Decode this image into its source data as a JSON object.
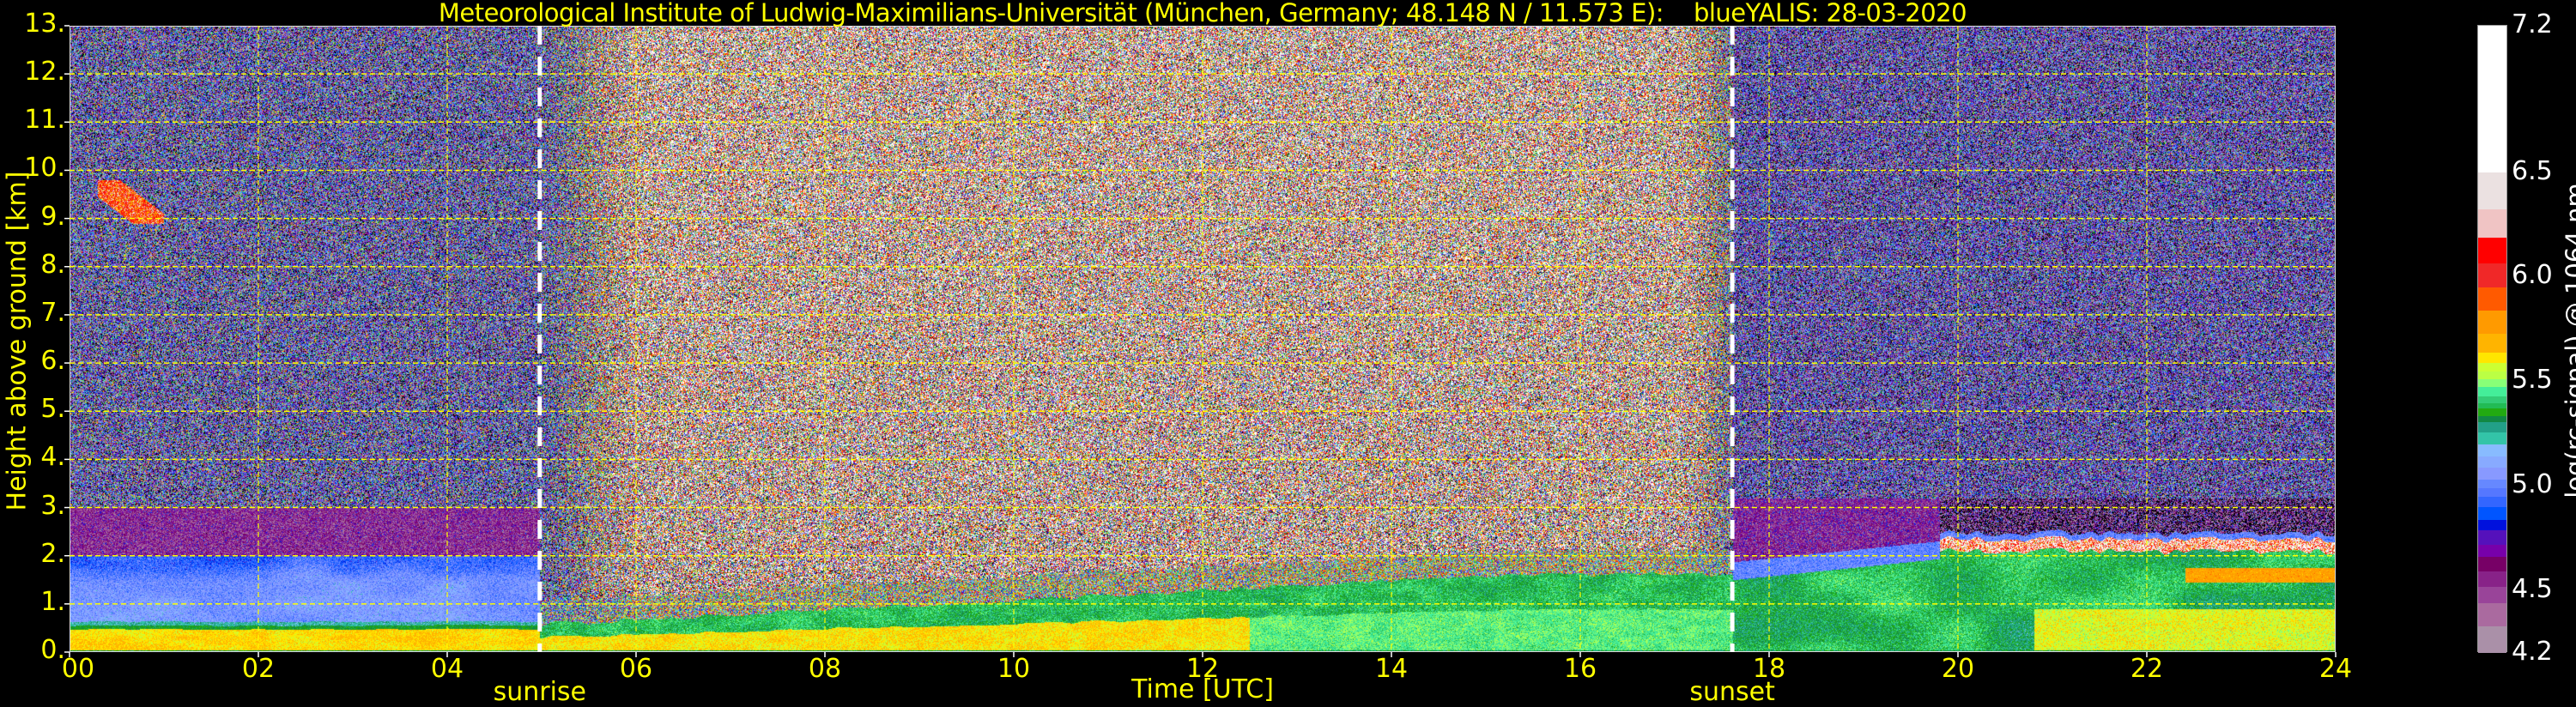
{
  "chart_data": {
    "type": "heatmap",
    "title": "Meteorological Institute of Ludwig-Maximilians-Universität (München, Germany; 48.148 N / 11.573 E):    blueYALIS: 28-03-2020",
    "xlabel": "Time [UTC]",
    "ylabel": "Height above ground [km]",
    "xlim": [
      0,
      24
    ],
    "ylim": [
      0,
      13
    ],
    "grid": true,
    "grid_color": "#ffff00",
    "x_ticks": [
      0,
      2,
      4,
      6,
      8,
      10,
      12,
      14,
      16,
      18,
      20,
      22,
      24
    ],
    "x_tick_labels": [
      "00",
      "02",
      "04",
      "06",
      "08",
      "10",
      "12",
      "14",
      "16",
      "18",
      "20",
      "22",
      "24"
    ],
    "y_ticks": [
      0,
      1,
      2,
      3,
      4,
      5,
      6,
      7,
      8,
      9,
      10,
      11,
      12,
      13
    ],
    "y_tick_labels": [
      "0.",
      "1.",
      "2.",
      "3.",
      "4.",
      "5.",
      "6.",
      "7.",
      "8.",
      "9.",
      "10.",
      "11.",
      "12.",
      "13."
    ],
    "annotations": [
      {
        "label": "sunrise",
        "time": 4.98
      },
      {
        "label": "sunset",
        "time": 17.61
      }
    ],
    "colorbar": {
      "label": "log(rc-signal) @ 1064 nm",
      "range": [
        4.2,
        7.2
      ],
      "ticks": [
        4.2,
        4.5,
        5.0,
        5.5,
        6.0,
        6.5,
        7.2
      ],
      "tick_labels": [
        "4.2",
        "4.5",
        "5.0",
        "5.5",
        "6.0",
        "6.5",
        "7.2"
      ],
      "levels": [
        {
          "from": 4.2,
          "color": "#aa90a8"
        },
        {
          "from": 4.33,
          "color": "#aa6a9f"
        },
        {
          "from": 4.44,
          "color": "#994499"
        },
        {
          "from": 4.52,
          "color": "#882288"
        },
        {
          "from": 4.59,
          "color": "#770066"
        },
        {
          "from": 4.66,
          "color": "#7700aa"
        },
        {
          "from": 4.72,
          "color": "#5511bb"
        },
        {
          "from": 4.79,
          "color": "#0011dd"
        },
        {
          "from": 4.84,
          "color": "#0055ff"
        },
        {
          "from": 4.9,
          "color": "#3366ff"
        },
        {
          "from": 4.95,
          "color": "#5577ff"
        },
        {
          "from": 4.99,
          "color": "#6688ff"
        },
        {
          "from": 5.03,
          "color": "#8899ff"
        },
        {
          "from": 5.09,
          "color": "#88aaff"
        },
        {
          "from": 5.14,
          "color": "#88bbff"
        },
        {
          "from": 5.2,
          "color": "#33c4a8"
        },
        {
          "from": 5.255,
          "color": "#22a088"
        },
        {
          "from": 5.305,
          "color": "#118844"
        },
        {
          "from": 5.335,
          "color": "#22aa11"
        },
        {
          "from": 5.37,
          "color": "#22bb55"
        },
        {
          "from": 5.395,
          "color": "#33cc77"
        },
        {
          "from": 5.43,
          "color": "#44ee99"
        },
        {
          "from": 5.475,
          "color": "#88ff77"
        },
        {
          "from": 5.51,
          "color": "#bbff44"
        },
        {
          "from": 5.55,
          "color": "#ccff33"
        },
        {
          "from": 5.59,
          "color": "#ffe600"
        },
        {
          "from": 5.64,
          "color": "#ffb400"
        },
        {
          "from": 5.73,
          "color": "#ff9a00"
        },
        {
          "from": 5.84,
          "color": "#ff5a00"
        },
        {
          "from": 5.95,
          "color": "#f02828"
        },
        {
          "from": 6.065,
          "color": "#ff0000"
        },
        {
          "from": 6.19,
          "color": "#f0c4c4"
        },
        {
          "from": 6.325,
          "color": "#ebe1e1"
        },
        {
          "from": 6.5,
          "color": "#ffffff"
        }
      ],
      "below_range_color": "#000000"
    }
  }
}
